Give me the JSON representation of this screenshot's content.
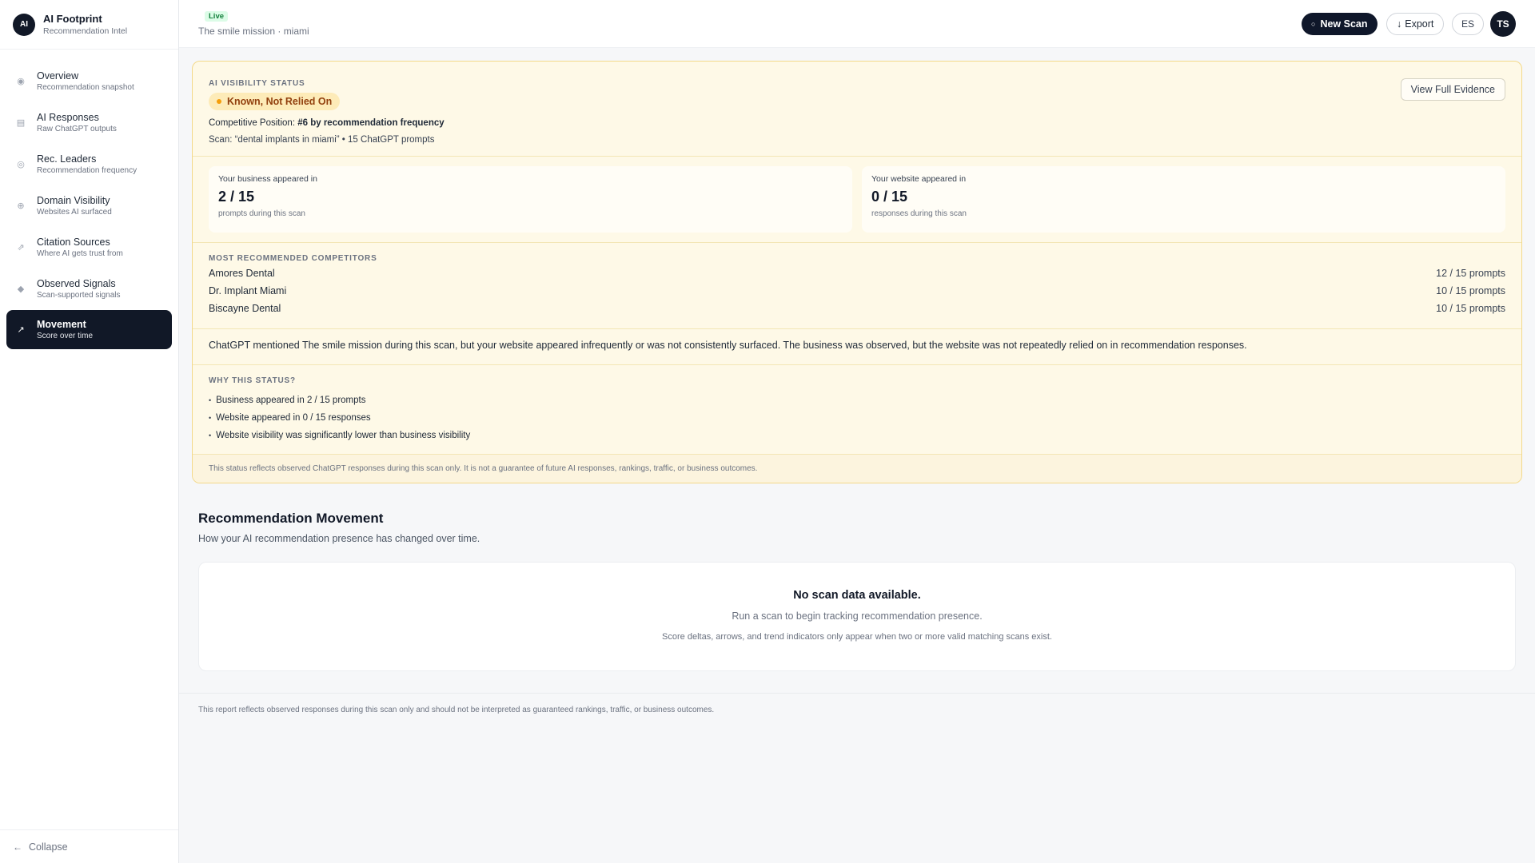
{
  "brand": {
    "logo": "AI",
    "name": "AI Footprint",
    "tagline": "Recommendation Intel"
  },
  "sidebar": {
    "items": [
      {
        "label": "Overview",
        "sub": "Recommendation snapshot",
        "icon": "◉"
      },
      {
        "label": "AI Responses",
        "sub": "Raw ChatGPT outputs",
        "icon": "▤"
      },
      {
        "label": "Rec. Leaders",
        "sub": "Recommendation frequency",
        "icon": "◎"
      },
      {
        "label": "Domain Visibility",
        "sub": "Websites AI surfaced",
        "icon": "⊕"
      },
      {
        "label": "Citation Sources",
        "sub": "Where AI gets trust from",
        "icon": "⇗"
      },
      {
        "label": "Observed Signals",
        "sub": "Scan-supported signals",
        "icon": "◆"
      },
      {
        "label": "Movement",
        "sub": "Score over time",
        "icon": "↗"
      }
    ],
    "collapse_label": "Collapse",
    "collapse_icon": "←"
  },
  "header": {
    "live": "Live",
    "subtitle": "The smile mission · miami",
    "new_scan": "New Scan",
    "new_scan_icon": "○",
    "export": "Export",
    "export_icon": "↓",
    "lang": "ES",
    "avatar": "TS"
  },
  "status": {
    "section_label": "AI VISIBILITY STATUS",
    "pill": "Known, Not Relied On",
    "view_evidence": "View Full Evidence",
    "comp_prefix": "Competitive Position: ",
    "comp_value": "#6 by recommendation frequency",
    "scan_line": "Scan: “dental implants in miami” • 15 ChatGPT prompts",
    "metrics": [
      {
        "label": "Your business appeared in",
        "value": "2 / 15",
        "sub": "prompts during this scan"
      },
      {
        "label": "Your website appeared in",
        "value": "0 / 15",
        "sub": "responses during this scan"
      }
    ],
    "competitors_label": "MOST RECOMMENDED COMPETITORS",
    "competitors": [
      {
        "name": "Amores Dental",
        "value": "12 / 15 prompts"
      },
      {
        "name": "Dr. Implant Miami",
        "value": "10 / 15 prompts"
      },
      {
        "name": "Biscayne Dental",
        "value": "10 / 15 prompts"
      }
    ],
    "note": "ChatGPT mentioned The smile mission during this scan, but your website appeared infrequently or was not consistently surfaced. The business was observed, but the website was not repeatedly relied on in recommendation responses.",
    "why_label": "WHY THIS STATUS?",
    "why_items": [
      "Business appeared in 2 / 15 prompts",
      "Website appeared in 0 / 15 responses",
      "Website visibility was significantly lower than business visibility"
    ],
    "disclaimer": "This status reflects observed ChatGPT responses during this scan only. It is not a guarantee of future AI responses, rankings, traffic, or business outcomes."
  },
  "movement": {
    "title": "Recommendation Movement",
    "subtitle": "How your AI recommendation presence has changed over time.",
    "empty_title": "No scan data available.",
    "empty_sub": "Run a scan to begin tracking recommendation presence.",
    "empty_note": "Score deltas, arrows, and trend indicators only appear when two or more valid matching scans exist."
  },
  "footer": "This report reflects observed responses during this scan only and should not be interpreted as guaranteed rankings, traffic, or business outcomes."
}
